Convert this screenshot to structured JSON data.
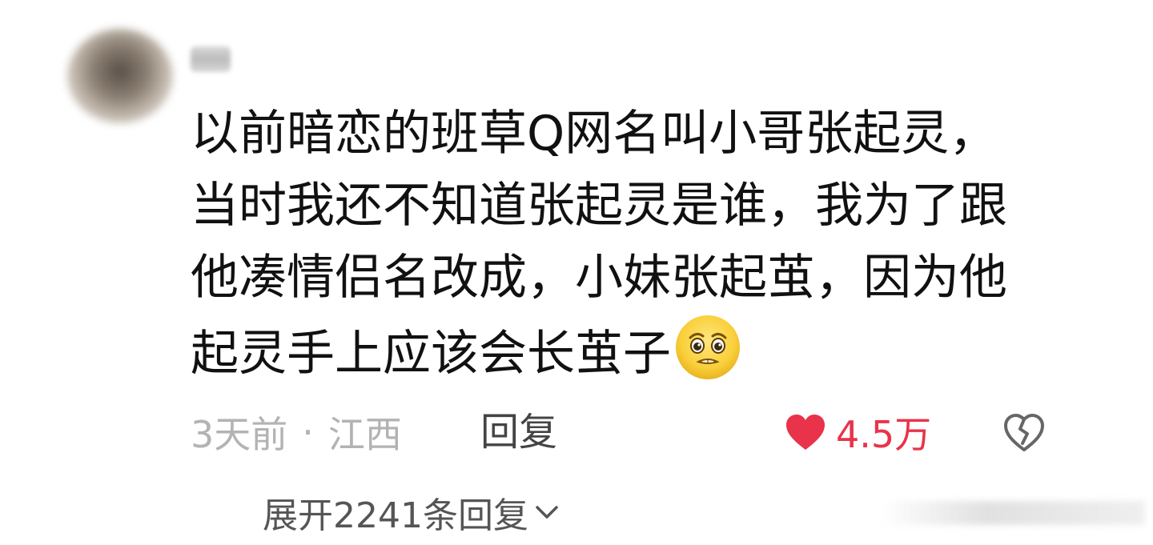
{
  "comment": {
    "lines": [
      "以前暗恋的班草Q网名叫小哥张起灵，",
      "当时我还不知道张起灵是谁，我为了跟",
      "他凑情侣名改成，小妹张起茧，因为他",
      "起灵手上应该会长茧子"
    ],
    "emoji": "pleading-face-emoji"
  },
  "meta": {
    "time": "3天前",
    "separator": "·",
    "location": "江西",
    "reply_label": "回复"
  },
  "likes": {
    "count": "4.5万",
    "color": "#e8334a",
    "icon": "heart-icon"
  },
  "dislike": {
    "icon": "broken-heart-icon"
  },
  "expand": {
    "label": "展开2241条回复",
    "icon": "chevron-down-icon"
  },
  "colors": {
    "text": "#111111",
    "meta": "#b3b3b3",
    "accent": "#e8334a"
  }
}
